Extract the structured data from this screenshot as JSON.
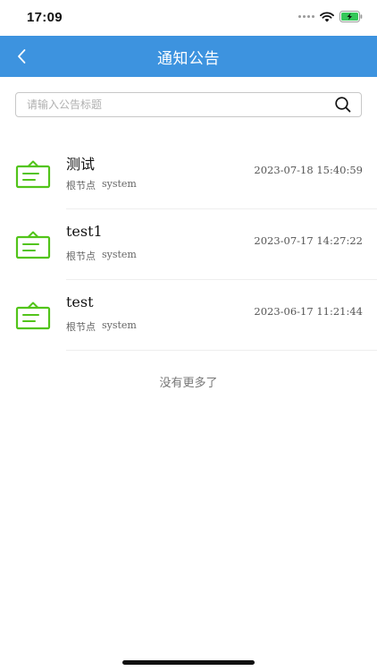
{
  "status_bar": {
    "time": "17:09",
    "icons": [
      "signal-icon",
      "wifi-icon",
      "battery-charging-icon"
    ]
  },
  "nav": {
    "title": "通知公告",
    "back_icon": "chevron-left-icon",
    "color": "#3d93df"
  },
  "search": {
    "placeholder": "请输入公告标题",
    "value": "",
    "icon": "search-icon"
  },
  "notices": [
    {
      "title": "测试",
      "dept": "根节点",
      "author": "system",
      "date": "2023-07-18 15:40:59",
      "icon": "notice-board-icon"
    },
    {
      "title": "test1",
      "dept": "根节点",
      "author": "system",
      "date": "2023-07-17 14:27:22",
      "icon": "notice-board-icon"
    },
    {
      "title": "test",
      "dept": "根节点",
      "author": "system",
      "date": "2023-06-17 11:21:44",
      "icon": "notice-board-icon"
    }
  ],
  "footer_text": "没有更多了",
  "colors": {
    "accent": "#3d93df",
    "icon_green": "#52c41a"
  }
}
